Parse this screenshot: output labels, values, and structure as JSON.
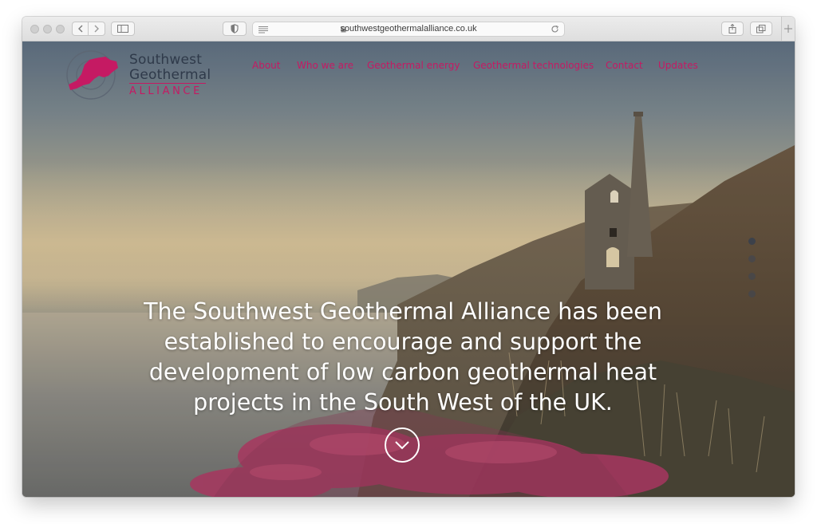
{
  "browser": {
    "url": "southwestgeothermalalliance.co.uk",
    "icons": {
      "back": "chevron-left-icon",
      "forward": "chevron-right-icon",
      "sidebar": "sidebar-icon",
      "shield": "shield-icon",
      "reader": "reader-icon",
      "lock": "lock-icon",
      "reload": "reload-icon",
      "share": "share-icon",
      "tabs": "tabs-icon",
      "new_tab": "plus-icon"
    }
  },
  "site": {
    "logo": {
      "line1": "Southwest",
      "line2": "Geothermal",
      "line3": "ALLIANCE",
      "icon": "map-region-icon"
    },
    "nav": [
      {
        "label": "About"
      },
      {
        "label": "Who we are"
      },
      {
        "label": "Geothermal energy"
      },
      {
        "label": "Geothermal technologies"
      },
      {
        "label": "Contact"
      },
      {
        "label": "Updates"
      }
    ],
    "hero": {
      "line1": "The Southwest Geothermal Alliance has been",
      "line2": "established to encourage and support the",
      "line3": "development of low carbon geothermal heat",
      "line4": "projects in the South West of the UK."
    },
    "scroll_icon": "chevron-down-circle-icon",
    "slide_count": 4
  },
  "colors": {
    "accent": "#c51a63",
    "logo_text": "#2f3a4a",
    "hero_text": "#ffffff"
  }
}
